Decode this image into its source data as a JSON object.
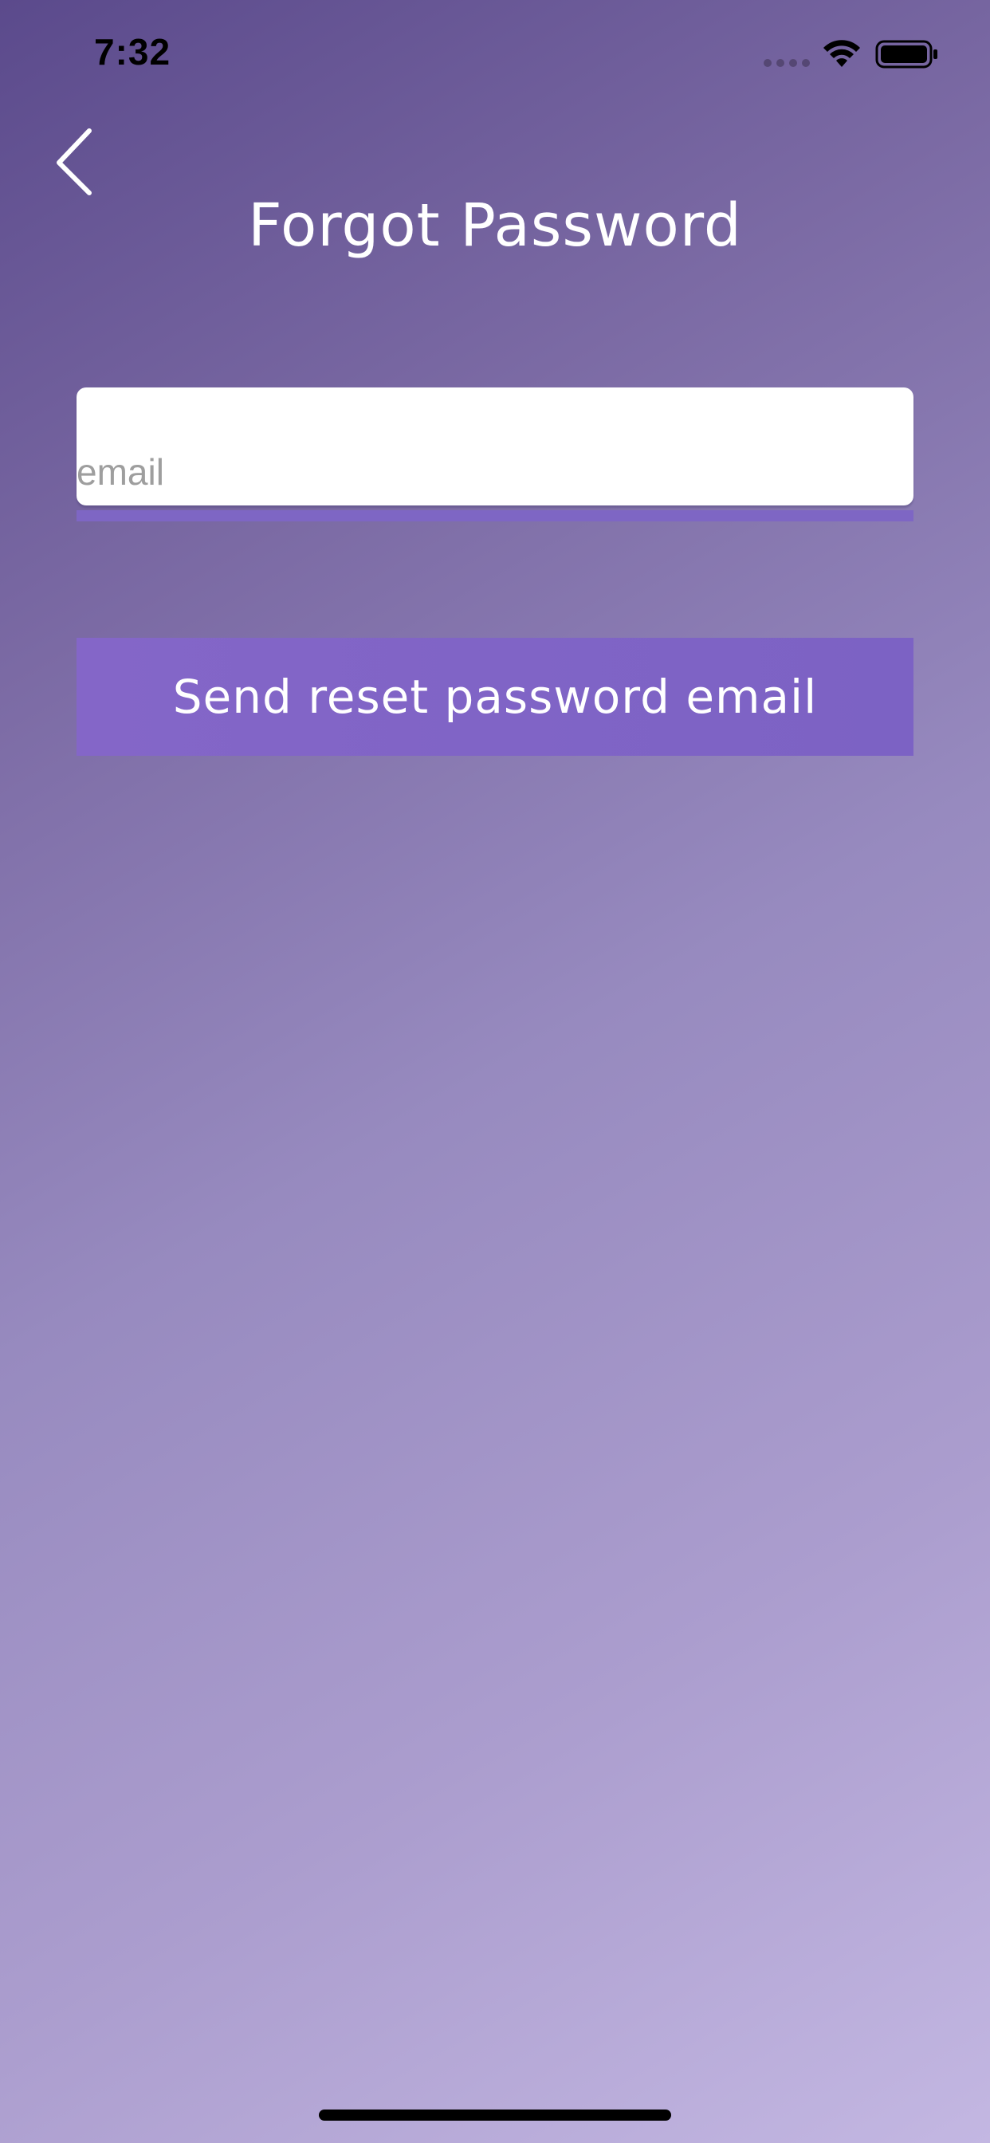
{
  "status_bar": {
    "time": "7:32",
    "icons": [
      "signal-dots-icon",
      "wifi-icon",
      "battery-icon"
    ]
  },
  "header": {
    "back_icon": "chevron-left-icon",
    "title": "Forgot Password"
  },
  "form": {
    "email": {
      "value": "",
      "placeholder": "email"
    },
    "submit_label": "Send reset password email"
  },
  "colors": {
    "accent": "#7e66c4",
    "title_text": "#ffffff",
    "background_start": "#5b4a8c",
    "background_end": "#c3b7e2"
  }
}
